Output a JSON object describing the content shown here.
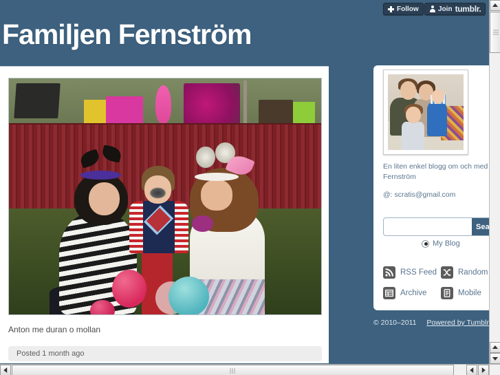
{
  "topbar": {
    "follow_label": "Follow",
    "join_label": "Join",
    "tumblr_wordmark": "tumblr."
  },
  "header": {
    "blog_title": "Familjen Fernström"
  },
  "post": {
    "caption": "Anton me duran o mollan",
    "footer_text": "Posted 1 month ago"
  },
  "sidebar": {
    "description": "En liten enkel blogg om och med fa\nFernström",
    "description_line1": "En liten enkel blogg om och med fa",
    "description_line2": "Fernström",
    "email_line": "@: scratis@gmail.com",
    "search": {
      "value": "",
      "placeholder": "",
      "submit_label": "Search"
    },
    "scope_radio": {
      "label": "My Blog",
      "selected": true
    },
    "links": [
      {
        "label": "RSS Feed",
        "icon": "rss-icon"
      },
      {
        "label": "Random",
        "icon": "shuffle-icon"
      },
      {
        "label": "Archive",
        "icon": "archive-icon"
      },
      {
        "label": "Mobile",
        "icon": "mobile-icon"
      }
    ]
  },
  "footer": {
    "copyright": "© 2010–2011",
    "powered_by": "Powered by Tumblr"
  },
  "colors": {
    "header_blue": "#3d617f",
    "link_blue": "#5a7590",
    "topbar_button": "#2b3f54",
    "icon_gray": "#5b5b5b"
  }
}
